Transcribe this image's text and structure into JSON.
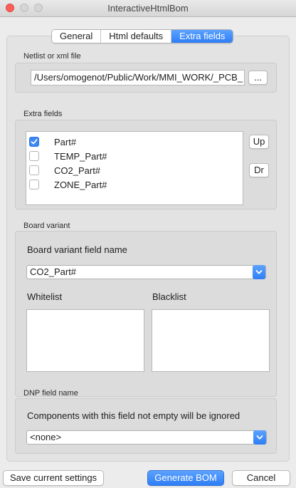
{
  "window": {
    "title": "InteractiveHtmlBom"
  },
  "tabs": [
    {
      "label": "General"
    },
    {
      "label": "Html defaults"
    },
    {
      "label": "Extra fields"
    }
  ],
  "netlist": {
    "group_label": "Netlist or xml file",
    "path_value": "/Users/omogenot/Public/Work/MMI_WORK/_PCB_",
    "browse_label": "..."
  },
  "extra_fields": {
    "group_label": "Extra fields",
    "items": [
      {
        "label": "Part#",
        "checked": true
      },
      {
        "label": "TEMP_Part#",
        "checked": false
      },
      {
        "label": "CO2_Part#",
        "checked": false
      },
      {
        "label": "ZONE_Part#",
        "checked": false
      }
    ],
    "up_label": "Up",
    "down_label": "Dr"
  },
  "board_variant": {
    "group_label": "Board variant",
    "field_name_label": "Board variant field name",
    "field_value": "CO2_Part#",
    "whitelist_label": "Whitelist",
    "blacklist_label": "Blacklist"
  },
  "dnp": {
    "group_label": "DNP field name",
    "description": "Components with this field not empty will be ignored",
    "field_value": "<none>"
  },
  "buttons": {
    "save_label": "Save current settings",
    "generate_label": "Generate BOM",
    "cancel_label": "Cancel"
  },
  "colors": {
    "accent": "#2f7ef6",
    "close": "#fc5f57"
  }
}
